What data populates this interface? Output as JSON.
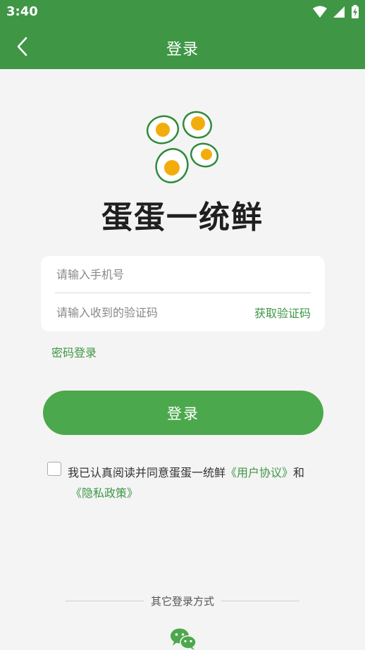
{
  "status_bar": {
    "time": "3:40",
    "icons": [
      "wifi-icon",
      "signal-icon",
      "battery-charging-icon"
    ]
  },
  "app_bar": {
    "title": "登录",
    "back_icon": "chevron-left-icon"
  },
  "brand": {
    "name": "蛋蛋一统鲜",
    "logo": "eggs-logo",
    "colors": {
      "green": "#3f9645",
      "yolk": "#f2ad0d"
    }
  },
  "form": {
    "phone_placeholder": "请输入手机号",
    "code_placeholder": "请输入收到的验证码",
    "get_code_label": "获取验证码"
  },
  "password_login_label": "密码登录",
  "login_button_label": "登录",
  "agreement": {
    "prefix": "我已认真阅读并同意蛋蛋一统鲜",
    "user_agreement": "《用户协议》",
    "conjunction": "和",
    "privacy_policy": "《隐私政策》"
  },
  "other_login": {
    "label": "其它登录方式",
    "wechat_icon": "wechat-icon"
  },
  "theme": {
    "primary": "#3f9645",
    "button": "#4ca84c",
    "background": "#f4f4f4"
  }
}
